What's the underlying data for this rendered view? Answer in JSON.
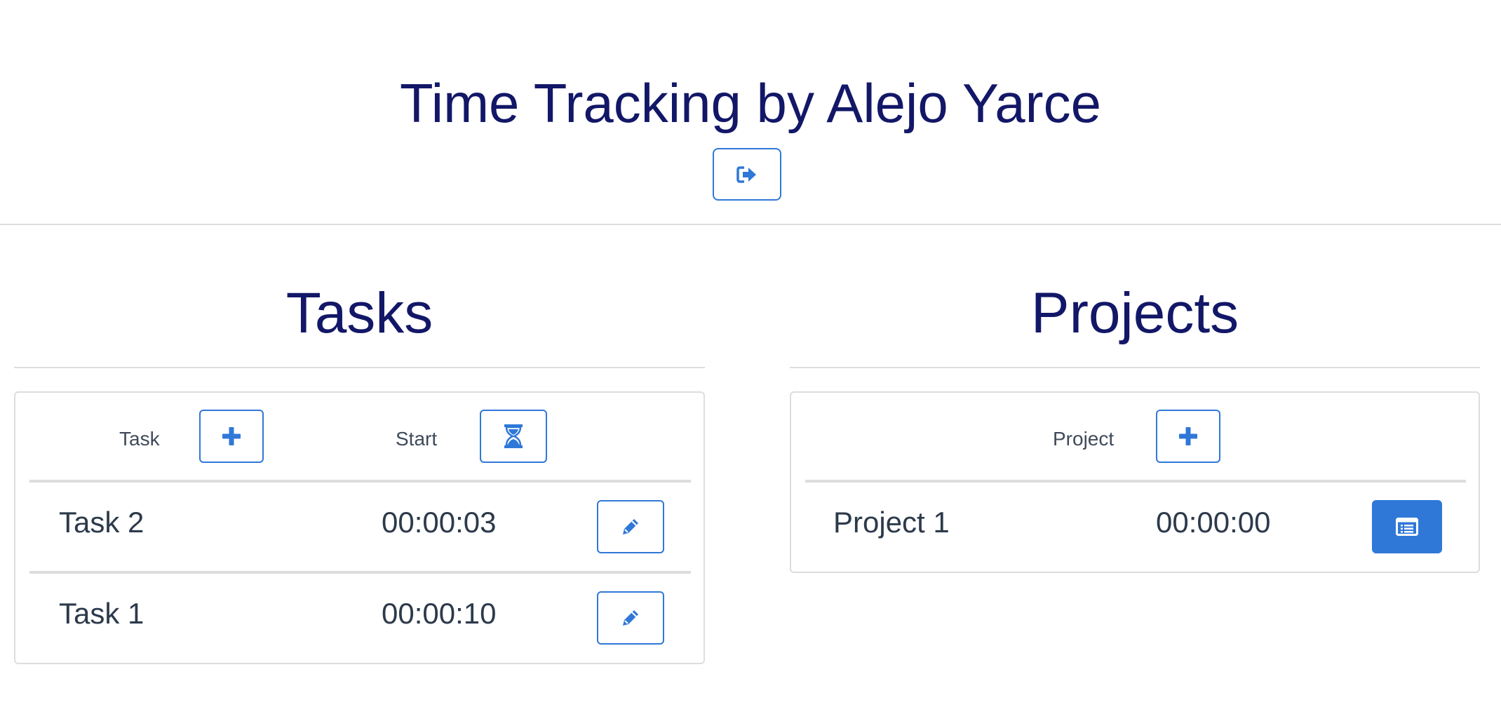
{
  "header": {
    "title": "Time Tracking by Alejo Yarce",
    "logout_icon": "sign-out-icon"
  },
  "tasks": {
    "title": "Tasks",
    "columns": {
      "task": "Task",
      "start": "Start"
    },
    "add_icon": "plus-icon",
    "start_icon": "hourglass-icon",
    "rows": [
      {
        "name": "Task 2",
        "time": "00:00:03",
        "action_icon": "pencil-icon"
      },
      {
        "name": "Task 1",
        "time": "00:00:10",
        "action_icon": "pencil-icon"
      }
    ]
  },
  "projects": {
    "title": "Projects",
    "columns": {
      "project": "Project"
    },
    "add_icon": "plus-icon",
    "rows": [
      {
        "name": "Project 1",
        "time": "00:00:00",
        "action_icon": "list-alt-icon"
      }
    ]
  },
  "colors": {
    "title": "#131767",
    "accent": "#2f78d8",
    "text": "#2c3a4b",
    "border": "#dddddd"
  }
}
